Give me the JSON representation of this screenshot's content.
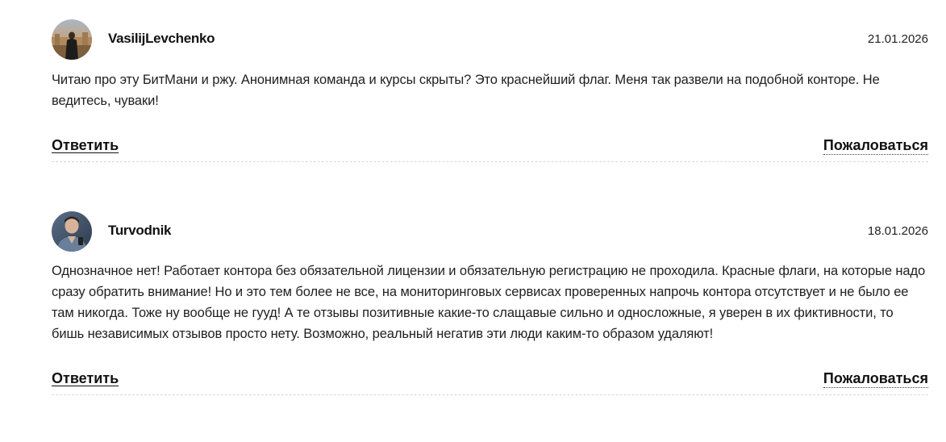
{
  "comments": [
    {
      "author": "VasilijLevchenko",
      "date": "21.01.2026",
      "text": "Читаю про эту БитМани и ржу. Анонимная команда и курсы скрыты? Это краснейший флаг. Меня так развели на подобной конторе. Не ведитесь, чуваки!",
      "reply_label": "Ответить",
      "report_label": "Пожаловаться"
    },
    {
      "author": "Turvodnik",
      "date": "18.01.2026",
      "text": "Однозначное нет! Работает контора без обязательной лицензии и обязательную регистрацию не проходила. Красные флаги, на которые надо сразу обратить внимание! Но и это тем более не все, на мониторинговых сервисах проверенных напрочь контора отсутствует и не было ее там никогда. Тоже ну вообще не гууд! А те отзывы позитивные какие-то слащавые сильно и односложные, я уверен в их фиктивности, то бишь независимых отзывов просто нету. Возможно, реальный негатив эти люди каким-то образом удаляют!",
      "reply_label": "Ответить",
      "report_label": "Пожаловаться"
    }
  ]
}
